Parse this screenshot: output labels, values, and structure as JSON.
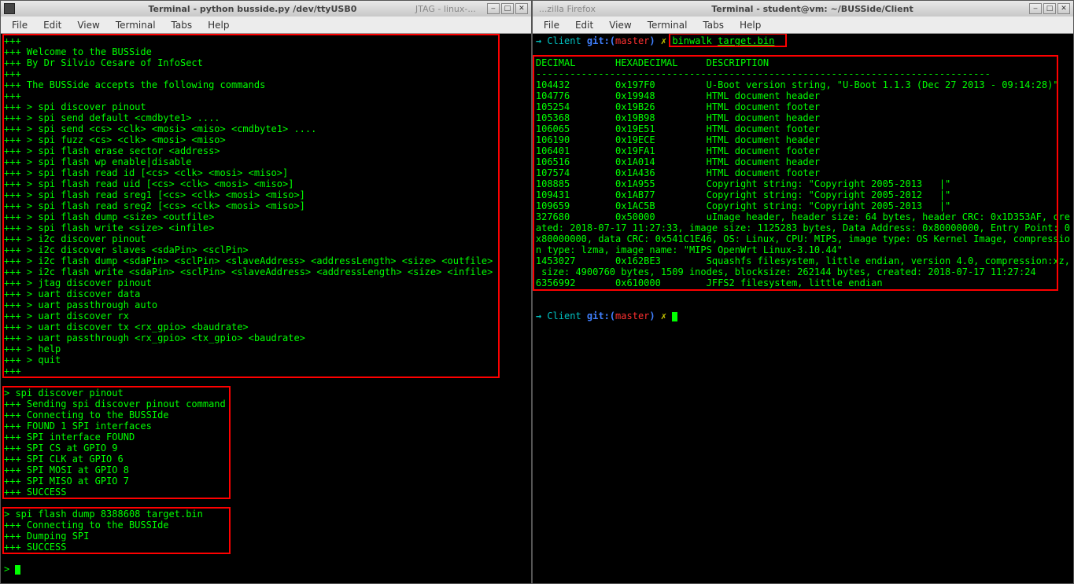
{
  "menus": [
    "File",
    "Edit",
    "View",
    "Terminal",
    "Tabs",
    "Help"
  ],
  "left": {
    "title": "Terminal - python busside.py /dev/ttyUSB0",
    "behind": "JTAG - linux-...",
    "block1": [
      "+++",
      "+++ Welcome to the BUSSide",
      "+++ By Dr Silvio Cesare of InfoSect",
      "+++",
      "+++ The BUSSide accepts the following commands",
      "+++",
      "+++ > spi discover pinout",
      "+++ > spi send default <cmdbyte1> ....",
      "+++ > spi send <cs> <clk> <mosi> <miso> <cmdbyte1> ....",
      "+++ > spi fuzz <cs> <clk> <mosi> <miso>",
      "+++ > spi flash erase sector <address>",
      "+++ > spi flash wp enable|disable",
      "+++ > spi flash read id [<cs> <clk> <mosi> <miso>]",
      "+++ > spi flash read uid [<cs> <clk> <mosi> <miso>]",
      "+++ > spi flash read sreg1 [<cs> <clk> <mosi> <miso>]",
      "+++ > spi flash read sreg2 [<cs> <clk> <mosi> <miso>]",
      "+++ > spi flash dump <size> <outfile>",
      "+++ > spi flash write <size> <infile>",
      "+++ > i2c discover pinout",
      "+++ > i2c discover slaves <sdaPin> <sclPin>",
      "+++ > i2c flash dump <sdaPin> <sclPin> <slaveAddress> <addressLength> <size> <outfile>",
      "+++ > i2c flash write <sdaPin> <sclPin> <slaveAddress> <addressLength> <size> <infile>",
      "+++ > jtag discover pinout",
      "+++ > uart discover data",
      "+++ > uart passthrough auto",
      "+++ > uart discover rx",
      "+++ > uart discover tx <rx_gpio> <baudrate>",
      "+++ > uart passthrough <rx_gpio> <tx_gpio> <baudrate>",
      "+++ > help",
      "+++ > quit",
      "+++"
    ],
    "block2": [
      "> spi discover pinout",
      "+++ Sending spi discover pinout command",
      "+++ Connecting to the BUSSIde",
      "+++ FOUND 1 SPI interfaces",
      "+++ SPI interface FOUND",
      "+++ SPI CS at GPIO 9",
      "+++ SPI CLK at GPIO 6",
      "+++ SPI MOSI at GPIO 8",
      "+++ SPI MISO at GPIO 7",
      "+++ SUCCESS"
    ],
    "block3": [
      "> spi flash dump 8388608 target.bin",
      "+++ Connecting to the BUSSIde",
      "+++ Dumping SPI",
      "+++ SUCCESS"
    ],
    "prompt": "> "
  },
  "right": {
    "title": "Terminal - student@vm: ~/BUSSide/Client",
    "behind_title": "...zilla Firefox",
    "prompt_parts": {
      "arrow": "→ ",
      "dir": "Client",
      "git_lbl": " git:(",
      "branch": "master",
      "git_close": ") ",
      "dirty": "✗ ",
      "cmd": "binwalk ",
      "arg": "target.bin"
    },
    "header": "DECIMAL       HEXADECIMAL     DESCRIPTION",
    "hr": "--------------------------------------------------------------------------------",
    "rows": [
      "104432        0x197F0         U-Boot version string, \"U-Boot 1.1.3 (Dec 27 2013 - 09:14:28)\"",
      "104776        0x19948         HTML document header",
      "105254        0x19B26         HTML document footer",
      "105368        0x19B98         HTML document header",
      "106065        0x19E51         HTML document footer",
      "106190        0x19ECE         HTML document header",
      "106401        0x19FA1         HTML document footer",
      "106516        0x1A014         HTML document header",
      "107574        0x1A436         HTML document footer",
      "108885        0x1A955         Copyright string: \"Copyright 2005-2013   |\"",
      "109431        0x1AB77         Copyright string: \"Copyright 2005-2012   |\"",
      "109659        0x1AC5B         Copyright string: \"Copyright 2005-2013   |\"",
      "327680        0x50000         uImage header, header size: 64 bytes, header CRC: 0x1D353AF, cre",
      "ated: 2018-07-17 11:27:33, image size: 1125283 bytes, Data Address: 0x80000000, Entry Point: 0",
      "x80000000, data CRC: 0x541C1E46, OS: Linux, CPU: MIPS, image type: OS Kernel Image, compressio",
      "n type: lzma, image name: \"MIPS OpenWrt Linux-3.10.44\"",
      "1453027       0x162BE3        Squashfs filesystem, little endian, version 4.0, compression:xz,",
      " size: 4900760 bytes, 1509 inodes, blocksize: 262144 bytes, created: 2018-07-17 11:27:24",
      "6356992       0x610000        JFFS2 filesystem, little endian"
    ]
  }
}
